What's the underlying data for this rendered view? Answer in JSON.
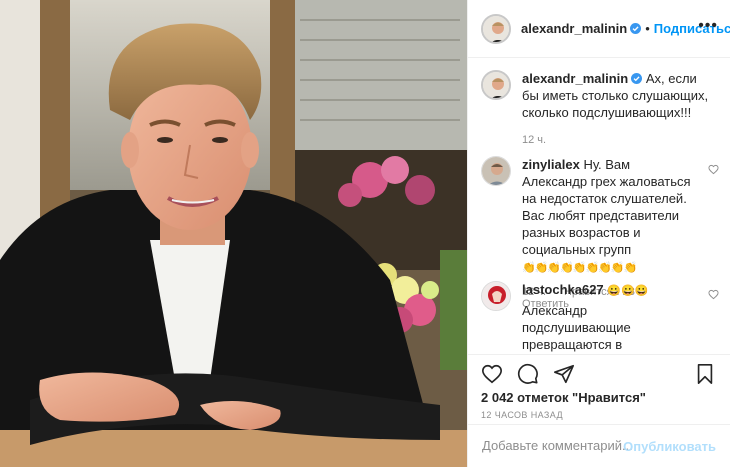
{
  "post": {
    "username": "alexandr_malinin",
    "follow_label": "Подписаться",
    "caption": "Ах, если бы иметь столько слушающих, сколько подслушивающих!!!",
    "caption_time": "12 ч.",
    "comments": [
      {
        "username": "zinylialex",
        "text": "Ну. Вам Александр грех жаловаться на недостаток слушателей. Вас любят представители разных возрастов и социальных групп",
        "emoji": "👏👏👏👏👏👏👏👏👏",
        "time": "12 ч.",
        "likes": "\"Нравится\": 28",
        "reply": "Ответить"
      },
      {
        "username": "lastochka627",
        "emoji": "😀😀😀",
        "text": "Александр подслушивающие превращаются в слушающих и наоборот. Мы все Вас любим."
      }
    ],
    "likes_count": "2 042 отметок \"Нравится\"",
    "time_ago": "12 ЧАСОВ НАЗАД",
    "comment_placeholder": "Добавьте комментарий...",
    "publish_label": "Опубликовать"
  },
  "icons": [
    "heart-icon",
    "comment-icon",
    "share-icon",
    "bookmark-icon",
    "verified-icon",
    "more-icon",
    "emoji-icon"
  ],
  "colors": {
    "accent": "#0095f6",
    "publish_disabled": "#b2dffc",
    "muted": "#8e8e8e"
  }
}
